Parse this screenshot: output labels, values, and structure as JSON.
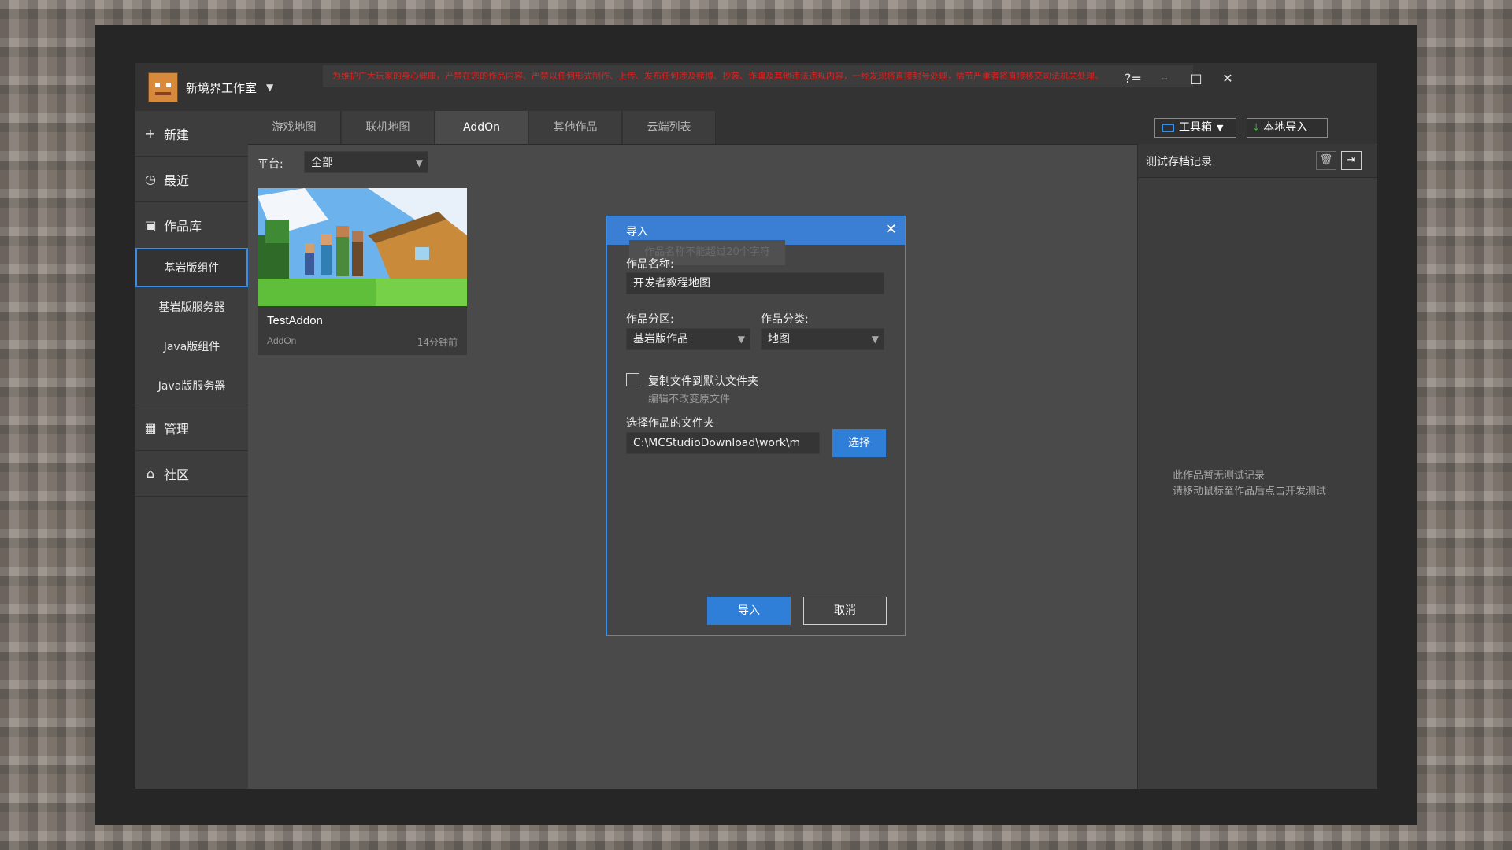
{
  "titlebar": {
    "studio_name": "新境界工作室",
    "notice": "为维护广大玩家的身心健康，严禁在您的作品内容、严禁以任何形式制作、上传、发布任何涉及赌博、抄袭、诈骗及其他违法违规内容，一经发现将直接封号处理，情节严重者将直接移交司法机关处理。",
    "help_icon": "?=",
    "minimize_icon": "–",
    "maximize_icon": "□",
    "close_icon": "✕"
  },
  "sidebar": {
    "new_label": "新建",
    "recent_label": "最近",
    "library_label": "作品库",
    "sub_items": [
      "基岩版组件",
      "基岩版服务器",
      "Java版组件",
      "Java版服务器"
    ],
    "manage_label": "管理",
    "community_label": "社区"
  },
  "tabs": [
    "游戏地图",
    "联机地图",
    "AddOn",
    "其他作品",
    "云端列表"
  ],
  "active_tab": "AddOn",
  "toolbar": {
    "toolbox_label": "工具箱",
    "local_import_label": "本地导入"
  },
  "filter": {
    "platform_label": "平台:",
    "platform_value": "全部"
  },
  "card": {
    "title": "TestAddon",
    "type": "AddOn",
    "time": "14分钟前"
  },
  "right_panel": {
    "title": "测试存档记录",
    "empty_line1": "此作品暂无测试记录",
    "empty_line2": "请移动鼠标至作品后点击开发测试"
  },
  "dialog": {
    "title": "导入",
    "tooltip": "作品名称不能超过20个字符",
    "name_label": "作品名称:",
    "name_value": "开发者教程地图",
    "zone_label": "作品分区:",
    "zone_value": "基岩版作品",
    "category_label": "作品分类:",
    "category_value": "地图",
    "copy_checkbox_label": "复制文件到默认文件夹",
    "copy_hint": "编辑不改变原文件",
    "folder_label": "选择作品的文件夹",
    "folder_value": "C:\\MCStudioDownload\\work\\m",
    "choose_button": "选择",
    "import_button": "导入",
    "cancel_button": "取消"
  },
  "colors": {
    "accent": "#3a8ee6",
    "primary_button": "#2f7ed8",
    "notice_text": "#e02020"
  }
}
